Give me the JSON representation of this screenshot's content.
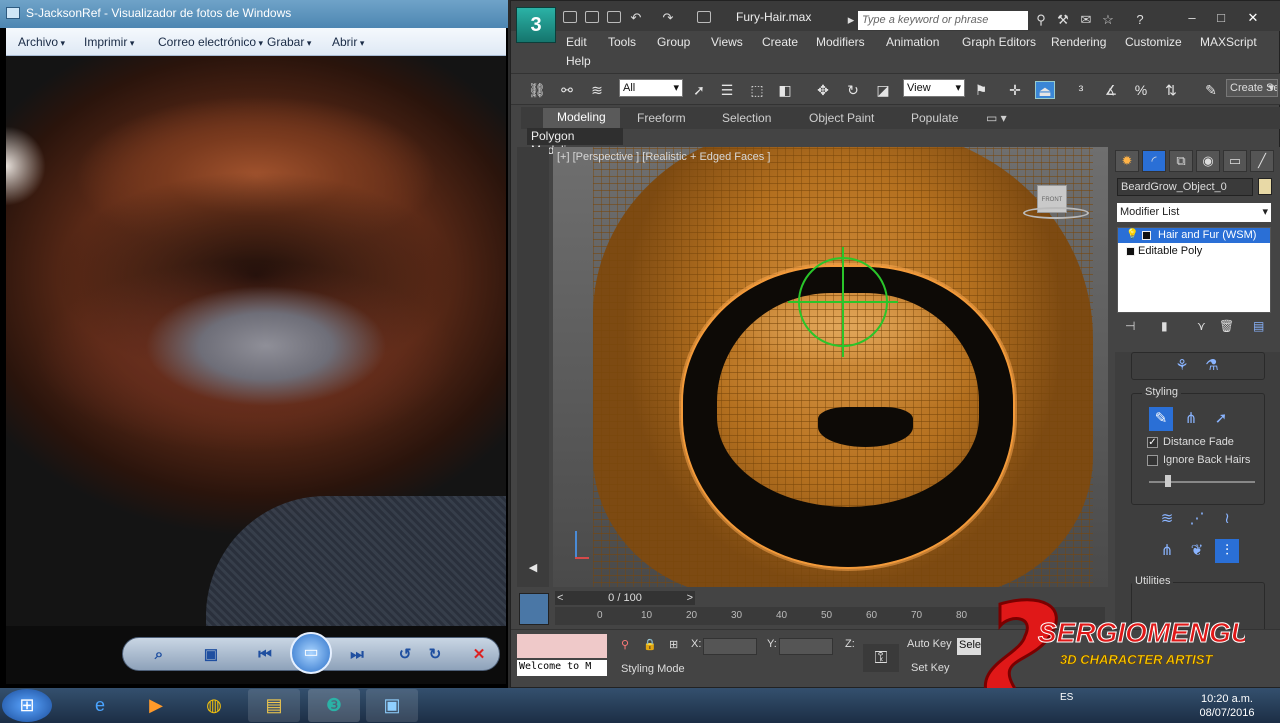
{
  "photo_viewer": {
    "title": "S-JacksonRef - Visualizador de fotos de Windows",
    "menu": [
      "Archivo",
      "Imprimir",
      "Correo electrónico",
      "Grabar",
      "Abrir"
    ]
  },
  "max": {
    "logo": "3",
    "file_title": "Fury-Hair.max",
    "search_placeholder": "Type a keyword or phrase",
    "help_icon": "?",
    "menu": [
      "Edit",
      "Tools",
      "Group",
      "Views",
      "Create",
      "Modifiers",
      "Animation",
      "Graph Editors",
      "Rendering",
      "Customize",
      "MAXScript",
      "Help"
    ],
    "toolbar": {
      "filter_select": "All",
      "refcoord_select": "View",
      "create_selection": "Create Selection"
    },
    "ribbon_tabs": [
      "Modeling",
      "Freeform",
      "Selection",
      "Object Paint",
      "Populate"
    ],
    "ribbon_panel": "Polygon Modeling",
    "viewport_label": "[+] [Perspective ] [Realistic + Edged Faces ]",
    "viewcube_label": "FRONT",
    "command_panel": {
      "object_name": "BeardGrow_Object_0",
      "modifier_list": "Modifier List",
      "stack": [
        "Hair and Fur (WSM)",
        "Editable Poly"
      ],
      "styling_label": "Styling",
      "distance_fade": "Distance Fade",
      "ignore_back_hairs": "Ignore Back Hairs",
      "utilities_label": "Utilities"
    },
    "timeline": {
      "frame": "0 / 100",
      "ticks": [
        "0",
        "10",
        "20",
        "30",
        "40",
        "50",
        "60",
        "70",
        "80"
      ]
    },
    "status": {
      "listener": "Welcome to M",
      "prompt": "Styling Mode",
      "x_label": "X:",
      "y_label": "Y:",
      "z_label": "Z:",
      "auto_key": "Auto Key",
      "set_key": "Set Key",
      "selected": "Sele"
    }
  },
  "watermark": {
    "line1": "SERGIOMENGUAL",
    "line2": "3D CHARACTER ARTIST"
  },
  "taskbar": {
    "lang": "ES",
    "time": "10:20 a.m.",
    "date": "08/07/2016"
  }
}
